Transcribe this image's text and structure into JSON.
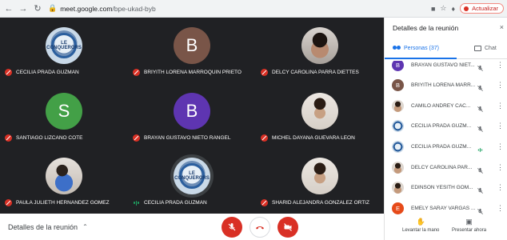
{
  "browser": {
    "url_host": "meet.google.com",
    "url_path": "/bpe-ukad-byb",
    "update_label": "Actualizar"
  },
  "tiles": [
    {
      "name": "CECILIA PRADA GUZMAN",
      "avatar": "logo",
      "logo_text": "LE CONQUERORS",
      "mic": "off"
    },
    {
      "name": "BRIYITH LORENA MARROQUIN PRIETO",
      "avatar": "letter",
      "letter": "B",
      "color": "#795548",
      "mic": "off"
    },
    {
      "name": "DELCY CAROLINA PARRA DIETTES",
      "avatar": "photo",
      "mic": "off"
    },
    {
      "name": "SANTIAGO LIZCANO COTE",
      "avatar": "letter",
      "letter": "S",
      "color": "#43a047",
      "mic": "off"
    },
    {
      "name": "BRAYAN GUSTAVO NIETO RANGEL",
      "avatar": "letter",
      "letter": "B",
      "color": "#5e35b1",
      "mic": "off"
    },
    {
      "name": "MICHEL DAYANA GUEVARA LEON",
      "avatar": "photo",
      "mic": "off"
    },
    {
      "name": "PAULA JULIETH HERNANDEZ GOMEZ",
      "avatar": "photo",
      "mic": "off"
    },
    {
      "name": "CECILIA PRADA GUZMAN",
      "avatar": "logo",
      "logo_text": "LE CONQUERORS",
      "mic": "talking"
    },
    {
      "name": "SHARID ALEJANDRA GONZALEZ ORTIZ",
      "avatar": "photo",
      "mic": "off"
    }
  ],
  "bottom_bar": {
    "meeting_details_label": "Detalles de la reunión"
  },
  "panel": {
    "title": "Detalles de la reunión",
    "tab_people_label": "Personas (37)",
    "tab_chat_label": "Chat",
    "people": [
      {
        "name": "BRAYAN GUSTAVO NIET...",
        "avatar": "letter",
        "letter": "B",
        "color": "#5e35b1",
        "mic": "off"
      },
      {
        "name": "BRIYITH LORENA MARR...",
        "avatar": "letter",
        "letter": "B",
        "color": "#795548",
        "mic": "off"
      },
      {
        "name": "CAMILO ANDREY CAC...",
        "avatar": "photo",
        "mic": "off"
      },
      {
        "name": "CECILIA PRADA GUZM...",
        "avatar": "logo",
        "mic": "off"
      },
      {
        "name": "CECILIA PRADA GUZM...",
        "avatar": "logo",
        "mic": "talking"
      },
      {
        "name": "DELCY CAROLINA PAR...",
        "avatar": "photo",
        "mic": "off"
      },
      {
        "name": "EDINSON YESITH GOM...",
        "avatar": "photo",
        "mic": "off"
      },
      {
        "name": "EMELY SARAY VARGAS ...",
        "avatar": "letter",
        "letter": "E",
        "color": "#e64a19",
        "mic": "off"
      }
    ],
    "raise_hand_label": "Levantar la mano",
    "present_label": "Presentar ahora"
  },
  "colors": {
    "stage_bg": "#202124",
    "accent_blue": "#1a73e8",
    "mic_off_red": "#d93025",
    "talking_green": "#1ea362"
  }
}
